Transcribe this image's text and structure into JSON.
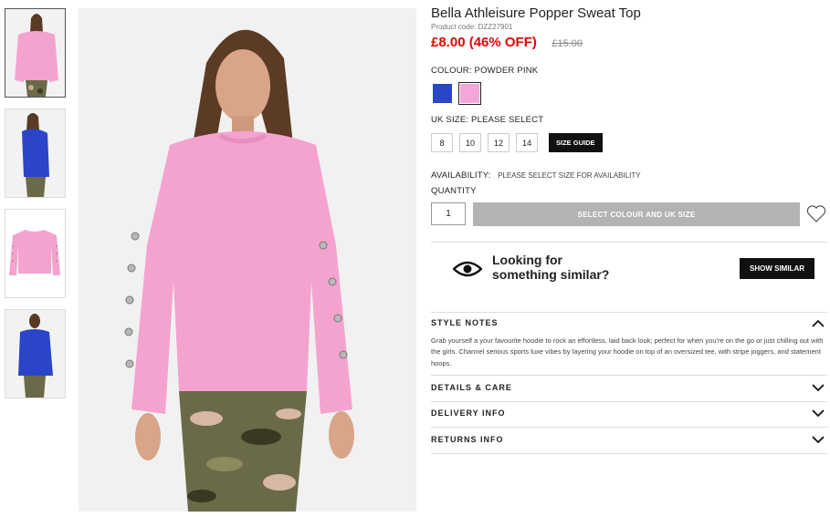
{
  "product": {
    "title": "Bella Athleisure Popper Sweat Top",
    "code": "Product code: DZZ27901",
    "price": "£8.00 (46% OFF)",
    "was_price": "£15.00"
  },
  "colour": {
    "label": "COLOUR:",
    "value": "POWDER PINK",
    "swatches": [
      {
        "name": "Cobalt",
        "color": "#2947c4"
      },
      {
        "name": "Powder Pink",
        "color": "#f2a6d9"
      }
    ]
  },
  "size": {
    "label": "UK SIZE:",
    "value": "PLEASE SELECT",
    "options": [
      "8",
      "10",
      "12",
      "14"
    ],
    "guide_label": "SIZE GUIDE"
  },
  "availability": {
    "label": "AVAILABILITY:",
    "value": "PLEASE SELECT SIZE FOR AVAILABILITY"
  },
  "quantity": {
    "label": "QUANTITY",
    "value": "1"
  },
  "add_button": "SELECT COLOUR AND UK SIZE",
  "similar": {
    "line1": "Looking for",
    "line2": "something similar?",
    "button": "SHOW SIMILAR"
  },
  "accordion": {
    "style_notes": {
      "title": "STYLE NOTES",
      "text": "Grab yourself a your favourite hoodie to rock an effortless, laid back look; perfect for when you're on the go or just chilling out with the girls. Channel serious sports luxe vibes by layering your hoodie on top of an oversized tee, with stripe joggers, and statement hoops."
    },
    "details": "DETAILS & CARE",
    "delivery": "DELIVERY INFO",
    "returns": "RETURNS INFO"
  },
  "icons": {
    "wishlist": "heart-icon",
    "similar": "eye-icon",
    "accordion_open": "chevron-up-icon",
    "accordion_closed": "chevron-down-icon"
  },
  "colors": {
    "price": "#e10600",
    "button_disabled": "#b3b3b3",
    "dark": "#111111"
  }
}
